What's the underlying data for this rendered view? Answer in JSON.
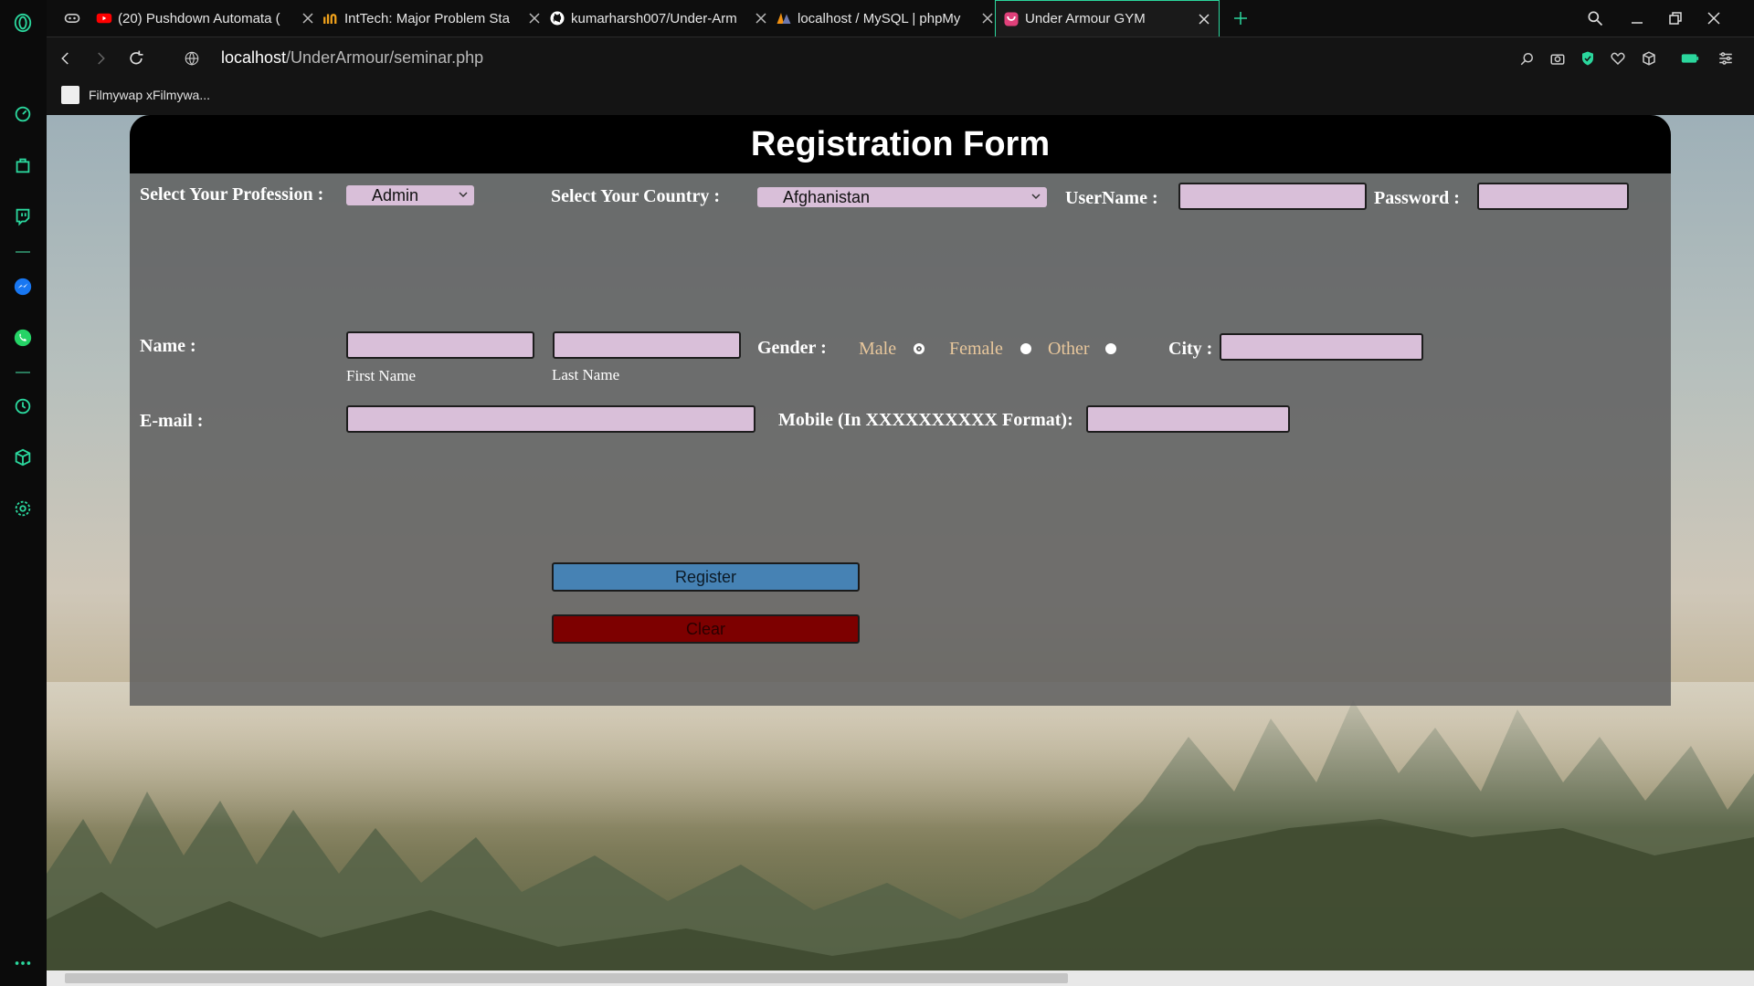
{
  "browser": {
    "tabs": [
      {
        "title": "(20) Pushdown Automata (",
        "favicon": "youtube-icon",
        "color": "#ff0000"
      },
      {
        "title": "IntTech: Major Problem Sta",
        "favicon": "inttech-icon",
        "color": "#f2a31c"
      },
      {
        "title": "kumarharsh007/Under-Arm",
        "favicon": "github-icon",
        "color": "#ffffff"
      },
      {
        "title": "localhost / MySQL | phpMy",
        "favicon": "phpmyadmin-icon",
        "color": "#f29111"
      },
      {
        "title": "Under Armour GYM",
        "favicon": "page-icon",
        "color": "#e0407a"
      }
    ],
    "active_tab_index": 4,
    "url_host": "localhost",
    "url_path": "/UnderArmour/seminar.php",
    "bookmark": "Filmywap xFilmywa...",
    "accent_color": "#2bd79d"
  },
  "form": {
    "title": "Registration Form",
    "profession_label": "Select Your Profession :",
    "profession_value": "Admin",
    "country_label": "Select Your Country :",
    "country_value": "Afghanistan",
    "username_label": "UserName :",
    "password_label": "Password :",
    "name_label": "Name :",
    "first_name_caption": "First Name",
    "last_name_caption": "Last Name",
    "gender_label": "Gender :",
    "gender_options": [
      "Male",
      "Female",
      "Other"
    ],
    "gender_selected": "Male",
    "city_label": "City :",
    "email_label": "E-mail :",
    "mobile_label": "Mobile (In XXXXXXXXXX Format):",
    "register_label": "Register",
    "clear_label": "Clear"
  }
}
